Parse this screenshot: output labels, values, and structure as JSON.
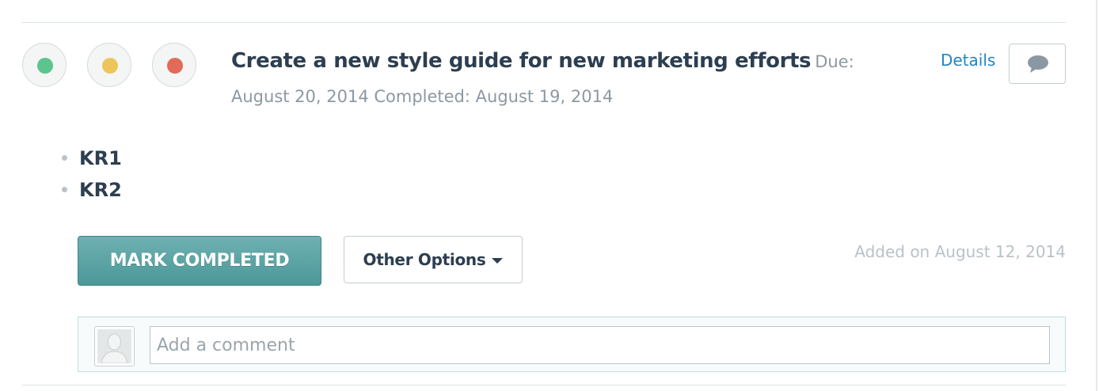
{
  "task": {
    "title": "Create a new style guide for new marketing efforts",
    "meta": "Due: August 20, 2014 Completed: August 19, 2014",
    "details_label": "Details",
    "key_results": [
      "KR1",
      "KR2"
    ],
    "added_on": "Added on August 12, 2014"
  },
  "status_options": [
    {
      "name": "green",
      "color": "#5cc48d"
    },
    {
      "name": "yellow",
      "color": "#ecc65a"
    },
    {
      "name": "red",
      "color": "#e16b57"
    }
  ],
  "actions": {
    "mark_completed_label": "MARK COMPLETED",
    "other_options_label": "Other Options"
  },
  "comment": {
    "placeholder": "Add a comment",
    "value": ""
  },
  "colors": {
    "accent": "#1f86c4",
    "primary_button": "#5aa3a4"
  }
}
